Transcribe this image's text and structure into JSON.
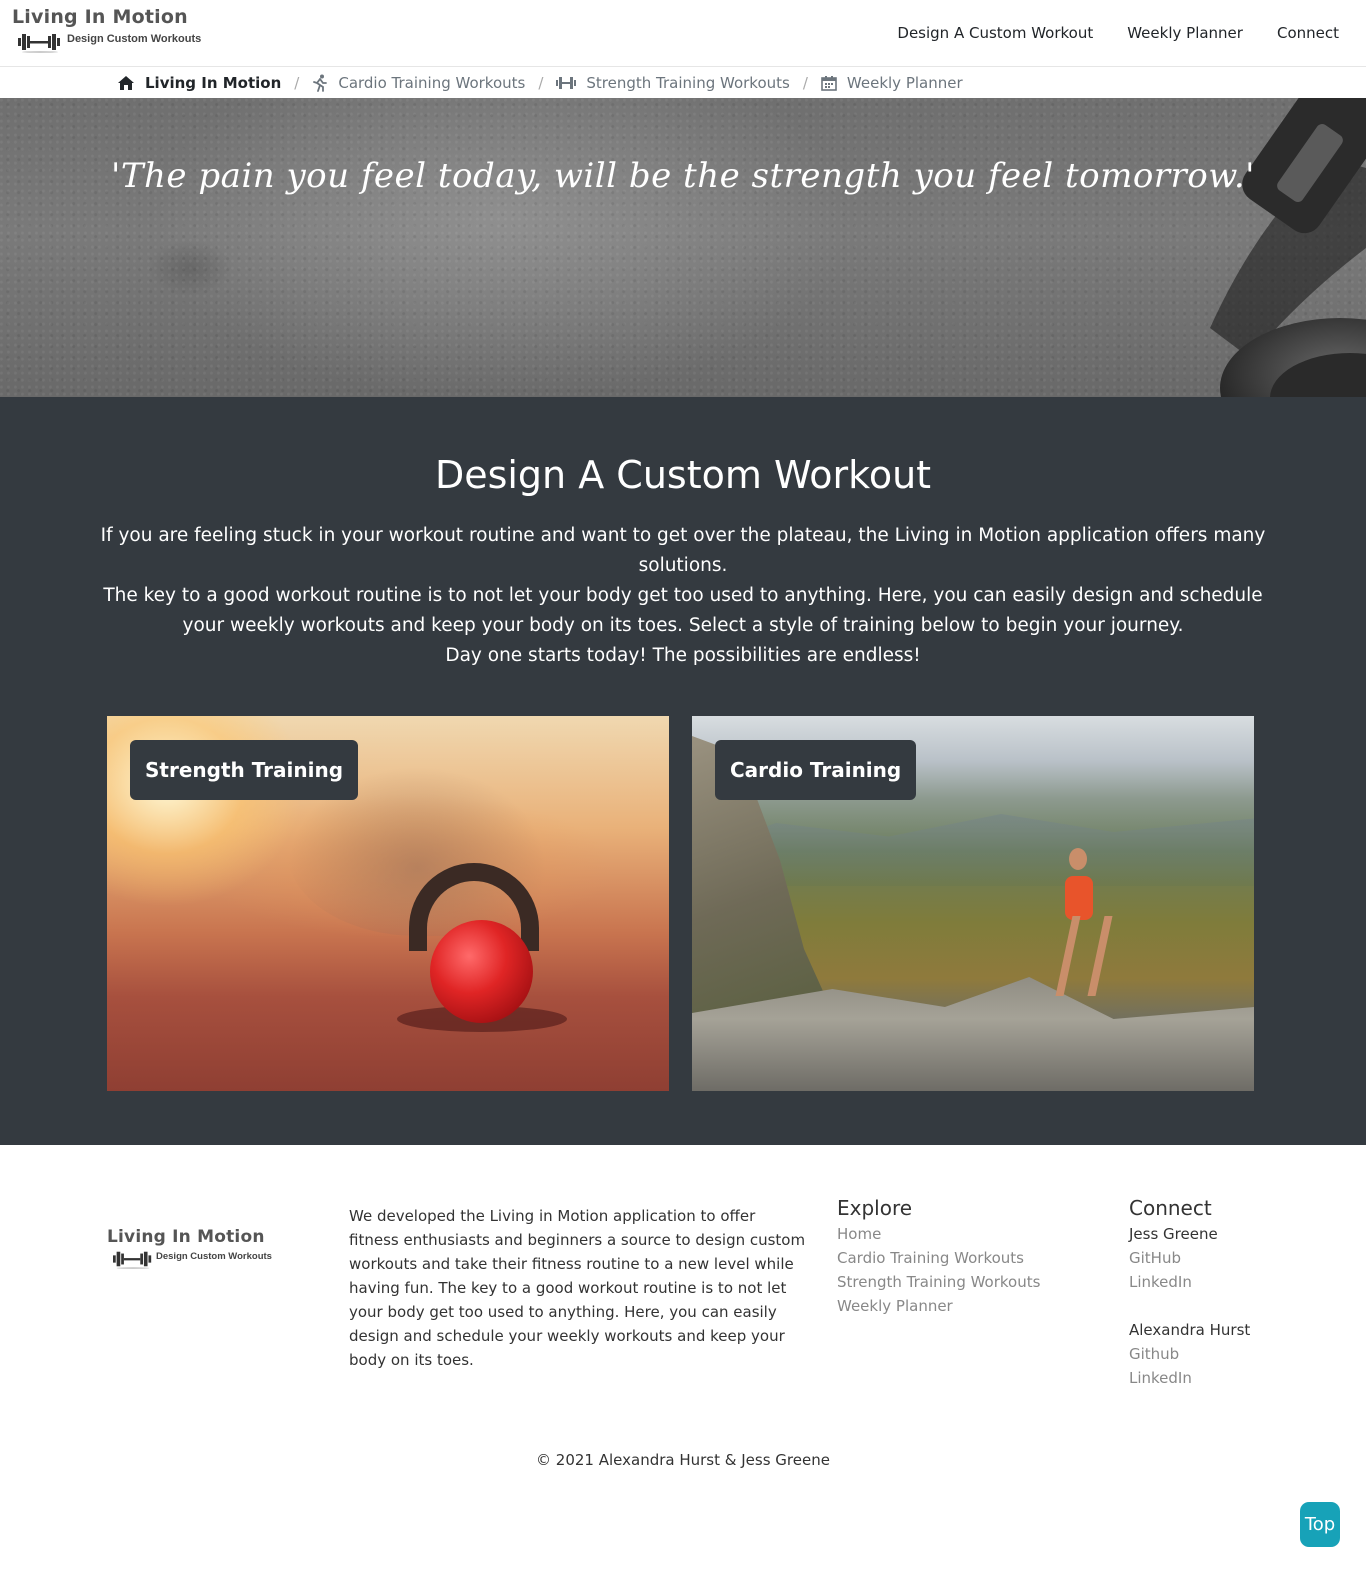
{
  "brand": {
    "title": "Living In Motion",
    "subtitle": "Design Custom Workouts"
  },
  "nav": {
    "links": [
      "Design A Custom Workout",
      "Weekly Planner",
      "Connect"
    ]
  },
  "breadcrumb": {
    "items": [
      {
        "label": "Living In Motion",
        "icon": "home-icon"
      },
      {
        "label": "Cardio Training Workouts",
        "icon": "running-icon"
      },
      {
        "label": "Strength Training Workouts",
        "icon": "dumbbell-icon"
      },
      {
        "label": "Weekly Planner",
        "icon": "calendar-icon"
      }
    ],
    "separator": "/"
  },
  "hero": {
    "quote": "'The pain you feel today, will be the strength you feel tomorrow.'"
  },
  "main": {
    "title": "Design A Custom Workout",
    "intro_lines": [
      "If you are feeling stuck in your workout routine and want to get over the plateau, the Living in Motion application offers many solutions.",
      "The key to a good workout routine is to not let your body get too used to anything. Here, you can easily design and schedule your weekly workouts and keep your body on its toes. Select a style of training below to begin your journey.",
      "Day one starts today! The possibilities are endless!"
    ],
    "cards": [
      {
        "label": "Strength Training"
      },
      {
        "label": "Cardio Training"
      }
    ]
  },
  "footer": {
    "about": "We developed the Living in Motion application to offer fitness enthusiasts and beginners a source to design custom workouts and take their fitness routine to a new level while having fun. The key to a good workout routine is to not let your body get too used to anything. Here, you can easily design and schedule your weekly workouts and keep your body on its toes.",
    "explore": {
      "heading": "Explore",
      "links": [
        "Home",
        "Cardio Training Workouts",
        "Strength Training Workouts",
        "Weekly Planner"
      ]
    },
    "connect": {
      "heading": "Connect",
      "people": [
        {
          "name": "Jess Greene",
          "links": [
            "GitHub",
            "LinkedIn"
          ]
        },
        {
          "name": "Alexandra Hurst",
          "links": [
            "Github",
            "LinkedIn"
          ]
        }
      ]
    },
    "copyright": "© 2021 Alexandra Hurst & Jess Greene",
    "top_button": "Top"
  },
  "colors": {
    "dark_section": "#343a40",
    "top_button": "#17a2b8",
    "muted_link": "#888888"
  }
}
